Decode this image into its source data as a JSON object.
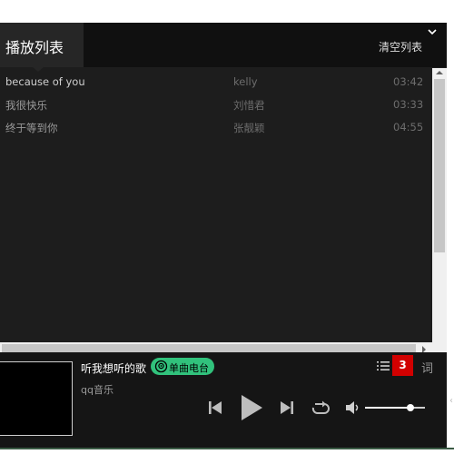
{
  "playlist": {
    "title": "播放列表",
    "clear_label": "清空列表",
    "songs": [
      {
        "name": "because of you",
        "artist": "kelly",
        "duration": "03:42"
      },
      {
        "name": "我很快乐",
        "artist": "刘惜君",
        "duration": "03:33"
      },
      {
        "name": "终于等到你",
        "artist": "张靓颖",
        "duration": "04:55"
      }
    ]
  },
  "player": {
    "song_title": "听我想听的歌",
    "radio_label": "单曲电台",
    "subtitle": "qq音乐",
    "playlist_count": "3",
    "lyrics_label": "词",
    "volume": 0.75
  },
  "colors": {
    "accent_green": "#31c27c",
    "badge_red": "#d10000",
    "panel_bg": "#1d1d1d"
  },
  "icons": [
    "collapse-chevron-icon",
    "radio-icon",
    "playlist-icon",
    "previous-icon",
    "play-icon",
    "next-icon",
    "repeat-icon",
    "volume-icon"
  ]
}
